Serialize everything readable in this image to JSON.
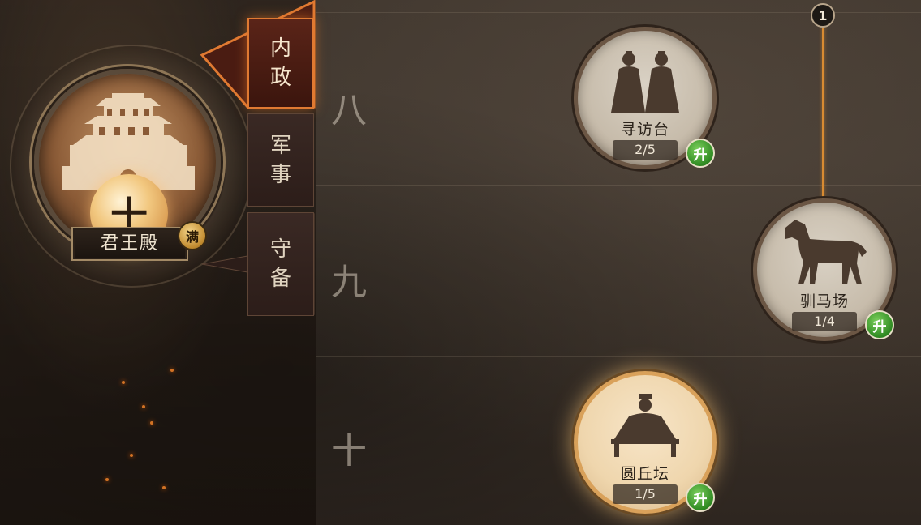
{
  "palace": {
    "name": "君王殿",
    "level": "十",
    "max_badge": "满"
  },
  "tabs": [
    {
      "label_line1": "内",
      "label_line2": "政",
      "active": true
    },
    {
      "label_line1": "军",
      "label_line2": "事",
      "active": false
    },
    {
      "label_line1": "守",
      "label_line2": "备",
      "active": false
    }
  ],
  "tiers": [
    "八",
    "九",
    "十"
  ],
  "buildings": [
    {
      "name": "寻访台",
      "progress": "2/5",
      "upgrade_label": "升",
      "icon": "two-scholars-icon",
      "highlight": false
    },
    {
      "name": "驯马场",
      "progress": "1/4",
      "upgrade_label": "升",
      "icon": "horse-icon",
      "highlight": false
    },
    {
      "name": "圆丘坛",
      "progress": "1/5",
      "upgrade_label": "升",
      "icon": "seated-emperor-icon",
      "highlight": true
    }
  ],
  "connector_badge": "1",
  "colors": {
    "active_tab_border": "#e07a32",
    "upgrade_green": "#2f8a22",
    "connector": "#d88b32"
  }
}
